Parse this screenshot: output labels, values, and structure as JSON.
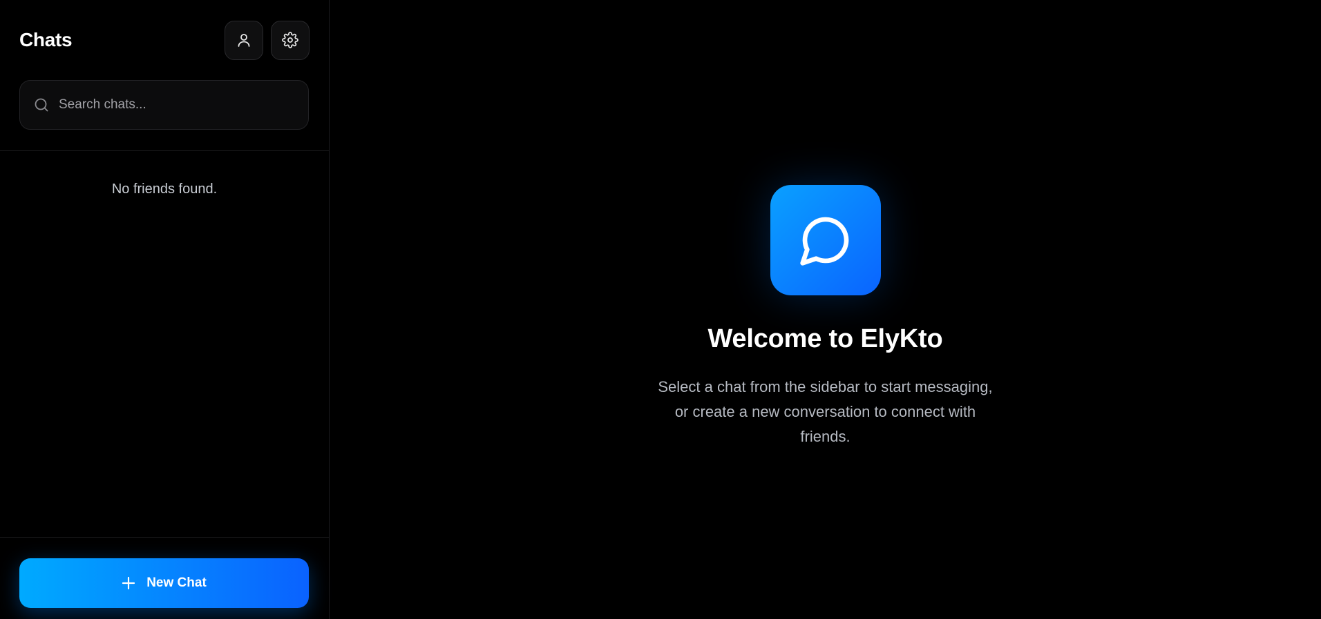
{
  "sidebar": {
    "title": "Chats",
    "header_buttons": [
      {
        "name": "profile",
        "icon": "user-icon"
      },
      {
        "name": "settings",
        "icon": "gear-icon"
      }
    ],
    "search": {
      "placeholder": "Search chats...",
      "value": "",
      "icon": "search-icon"
    },
    "empty_state": "No friends found.",
    "new_chat": {
      "label": "New Chat",
      "icon": "plus-icon"
    }
  },
  "main": {
    "logo_icon": "message-circle-icon",
    "welcome_title": "Welcome to ElyKto",
    "welcome_subtitle": "Select a chat from the sidebar to start messaging, or create a new conversation to connect with friends."
  },
  "colors": {
    "background": "#000000",
    "accent_start": "#00aaff",
    "accent_end": "#0a62ff",
    "muted_text": "#b6bac2"
  }
}
